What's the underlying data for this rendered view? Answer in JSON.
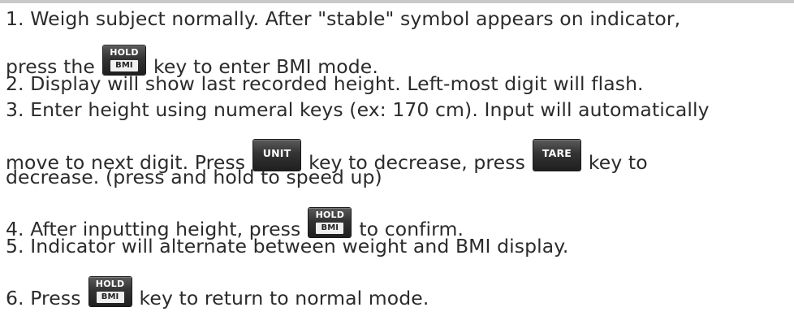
{
  "steps": {
    "s1_a": "1. Weigh subject normally. After \"stable\" symbol appears on indicator,",
    "s1_b_pre": "press the",
    "s1_b_post": "key to enter BMI mode.",
    "s2": "2. Display will show last recorded height. Left-most digit will flash.",
    "s3_a": "3. Enter height using numeral keys (ex: 170 cm). Input will automatically",
    "s3_b_pre": "move to next digit. Press",
    "s3_b_mid": "key to decrease, press",
    "s3_b_post": "key to",
    "s3_c": "decrease. (press and hold to speed up)",
    "s4_pre": "4. After inputting height, press",
    "s4_post": "to confirm.",
    "s5": "5. Indicator will alternate between weight and BMI display.",
    "s6_pre": "6. Press",
    "s6_post": "key to return to normal mode."
  },
  "keys": {
    "hold_bmi": {
      "top": "HOLD",
      "bottom": "BMI",
      "icon": "hold-bmi-key-icon"
    },
    "unit": {
      "label": "UNIT",
      "icon": "unit-key-icon"
    },
    "tare": {
      "label": "TARE",
      "icon": "tare-key-icon"
    }
  },
  "colors": {
    "text": "#2b2b2b",
    "key_body": "#333333",
    "key_inset": "#efefef",
    "top_rule": "#c9c9c9"
  }
}
